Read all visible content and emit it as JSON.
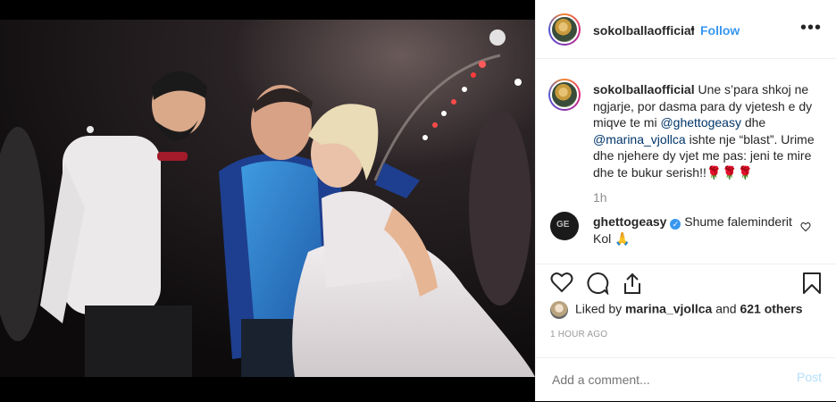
{
  "post": {
    "username": "sokolballaofficial",
    "separator": "•",
    "follow_label": "Follow",
    "more_icon": "•••"
  },
  "caption": {
    "username": "sokolballaofficial",
    "text_1": "Une s’para shkoj ne ngjarje, por dasma para dy vjetesh e dy miqve te mi ",
    "mention_1": "@ghettogeasy",
    "text_2": " dhe ",
    "mention_2": "@marina_vjollca",
    "text_3": " ishte nje “blast”. Urime dhe njehere dy vjet me pas: jeni te mire dhe te bukur serish!!🌹🌹🌹",
    "time": "1h"
  },
  "reply": {
    "username": "ghettogeasy",
    "verified_mark": "✓",
    "text": "Shume faleminderit Kol 🙏",
    "avatar_text": "GE"
  },
  "likes": {
    "prefix": "Liked by ",
    "user": "marina_vjollca",
    "middle": " and ",
    "count_text": "621 others"
  },
  "timestamp": "1 HOUR AGO",
  "add_comment": {
    "placeholder": "Add a comment...",
    "post_label": "Post"
  },
  "colors": {
    "link_blue": "#3897f0",
    "mention_blue": "#003569",
    "muted_gray": "#8e8e8e",
    "post_disabled": "#b2dffc"
  }
}
